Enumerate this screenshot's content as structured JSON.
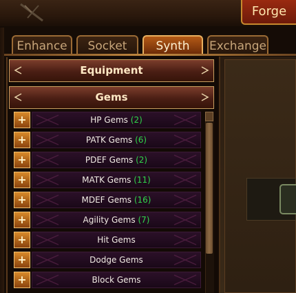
{
  "window": {
    "title": "Forge"
  },
  "tabs": [
    {
      "label": "Enhance",
      "active": false
    },
    {
      "label": "Socket",
      "active": false
    },
    {
      "label": "Synth",
      "active": true
    },
    {
      "label": "Exchange",
      "active": false
    }
  ],
  "categories": {
    "equipment": "Equipment",
    "gems": "Gems"
  },
  "gem_list": [
    {
      "name": "HP Gems",
      "count": "(2)"
    },
    {
      "name": "PATK Gems",
      "count": "(6)"
    },
    {
      "name": "PDEF Gems",
      "count": "(2)"
    },
    {
      "name": "MATK Gems",
      "count": "(11)"
    },
    {
      "name": "MDEF Gems",
      "count": "(16)"
    },
    {
      "name": "Agility Gems",
      "count": "(7)"
    },
    {
      "name": "Hit Gems",
      "count": ""
    },
    {
      "name": "Dodge Gems",
      "count": ""
    },
    {
      "name": "Block Gems",
      "count": ""
    }
  ],
  "icons": {
    "expand": "plus-icon",
    "category_left": "arrow-left-icon",
    "category_right": "arrow-right-icon"
  },
  "colors": {
    "count_text": "#2fd64a",
    "active_tab": "#b45a16"
  }
}
